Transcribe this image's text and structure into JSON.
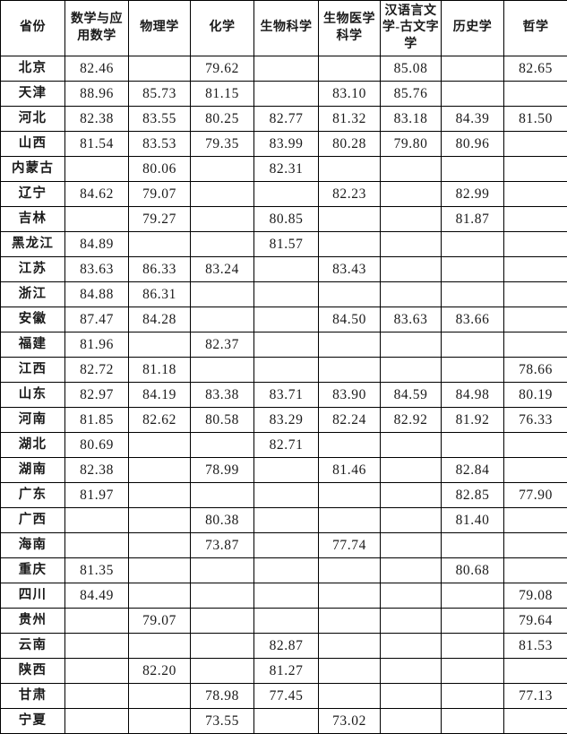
{
  "table": {
    "columns": [
      "省份",
      "数学与应用数学",
      "物理学",
      "化学",
      "生物科学",
      "生物医学科学",
      "汉语言文学-古文字学",
      "历史学",
      "哲学"
    ],
    "rows": [
      {
        "province": "北京",
        "values": [
          "82.46",
          "",
          "79.62",
          "",
          "",
          "85.08",
          "",
          "82.65"
        ]
      },
      {
        "province": "天津",
        "values": [
          "88.96",
          "85.73",
          "81.15",
          "",
          "83.10",
          "85.76",
          "",
          ""
        ]
      },
      {
        "province": "河北",
        "values": [
          "82.38",
          "83.55",
          "80.25",
          "82.77",
          "81.32",
          "83.18",
          "84.39",
          "81.50"
        ]
      },
      {
        "province": "山西",
        "values": [
          "81.54",
          "83.53",
          "79.35",
          "83.99",
          "80.28",
          "79.80",
          "80.96",
          ""
        ]
      },
      {
        "province": "内蒙古",
        "values": [
          "",
          "80.06",
          "",
          "82.31",
          "",
          "",
          "",
          ""
        ]
      },
      {
        "province": "辽宁",
        "values": [
          "84.62",
          "79.07",
          "",
          "",
          "82.23",
          "",
          "82.99",
          ""
        ]
      },
      {
        "province": "吉林",
        "values": [
          "",
          "79.27",
          "",
          "80.85",
          "",
          "",
          "81.87",
          ""
        ]
      },
      {
        "province": "黑龙江",
        "values": [
          "84.89",
          "",
          "",
          "81.57",
          "",
          "",
          "",
          ""
        ]
      },
      {
        "province": "江苏",
        "values": [
          "83.63",
          "86.33",
          "83.24",
          "",
          "83.43",
          "",
          "",
          ""
        ]
      },
      {
        "province": "浙江",
        "values": [
          "84.88",
          "86.31",
          "",
          "",
          "",
          "",
          "",
          ""
        ]
      },
      {
        "province": "安徽",
        "values": [
          "87.47",
          "84.28",
          "",
          "",
          "84.50",
          "83.63",
          "83.66",
          ""
        ]
      },
      {
        "province": "福建",
        "values": [
          "81.96",
          "",
          "82.37",
          "",
          "",
          "",
          "",
          ""
        ]
      },
      {
        "province": "江西",
        "values": [
          "82.72",
          "81.18",
          "",
          "",
          "",
          "",
          "",
          "78.66"
        ]
      },
      {
        "province": "山东",
        "values": [
          "82.97",
          "84.19",
          "83.38",
          "83.71",
          "83.90",
          "84.59",
          "84.98",
          "80.19"
        ]
      },
      {
        "province": "河南",
        "values": [
          "81.85",
          "82.62",
          "80.58",
          "83.29",
          "82.24",
          "82.92",
          "81.92",
          "76.33"
        ]
      },
      {
        "province": "湖北",
        "values": [
          "80.69",
          "",
          "",
          "82.71",
          "",
          "",
          "",
          ""
        ]
      },
      {
        "province": "湖南",
        "values": [
          "82.38",
          "",
          "78.99",
          "",
          "81.46",
          "",
          "82.84",
          ""
        ]
      },
      {
        "province": "广东",
        "values": [
          "81.97",
          "",
          "",
          "",
          "",
          "",
          "82.85",
          "77.90"
        ]
      },
      {
        "province": "广西",
        "values": [
          "",
          "",
          "80.38",
          "",
          "",
          "",
          "81.40",
          ""
        ]
      },
      {
        "province": "海南",
        "values": [
          "",
          "",
          "73.87",
          "",
          "77.74",
          "",
          "",
          ""
        ]
      },
      {
        "province": "重庆",
        "values": [
          "81.35",
          "",
          "",
          "",
          "",
          "",
          "80.68",
          ""
        ]
      },
      {
        "province": "四川",
        "values": [
          "84.49",
          "",
          "",
          "",
          "",
          "",
          "",
          "79.08"
        ]
      },
      {
        "province": "贵州",
        "values": [
          "",
          "79.07",
          "",
          "",
          "",
          "",
          "",
          "79.64"
        ]
      },
      {
        "province": "云南",
        "values": [
          "",
          "",
          "",
          "82.87",
          "",
          "",
          "",
          "81.53"
        ]
      },
      {
        "province": "陕西",
        "values": [
          "",
          "82.20",
          "",
          "81.27",
          "",
          "",
          "",
          ""
        ]
      },
      {
        "province": "甘肃",
        "values": [
          "",
          "",
          "78.98",
          "77.45",
          "",
          "",
          "",
          "77.13"
        ]
      },
      {
        "province": "宁夏",
        "values": [
          "",
          "",
          "73.55",
          "",
          "73.02",
          "",
          "",
          ""
        ]
      }
    ]
  },
  "style": {
    "border_color": "#000000",
    "text_color": "#1a1a1a",
    "background": "#ffffff"
  }
}
